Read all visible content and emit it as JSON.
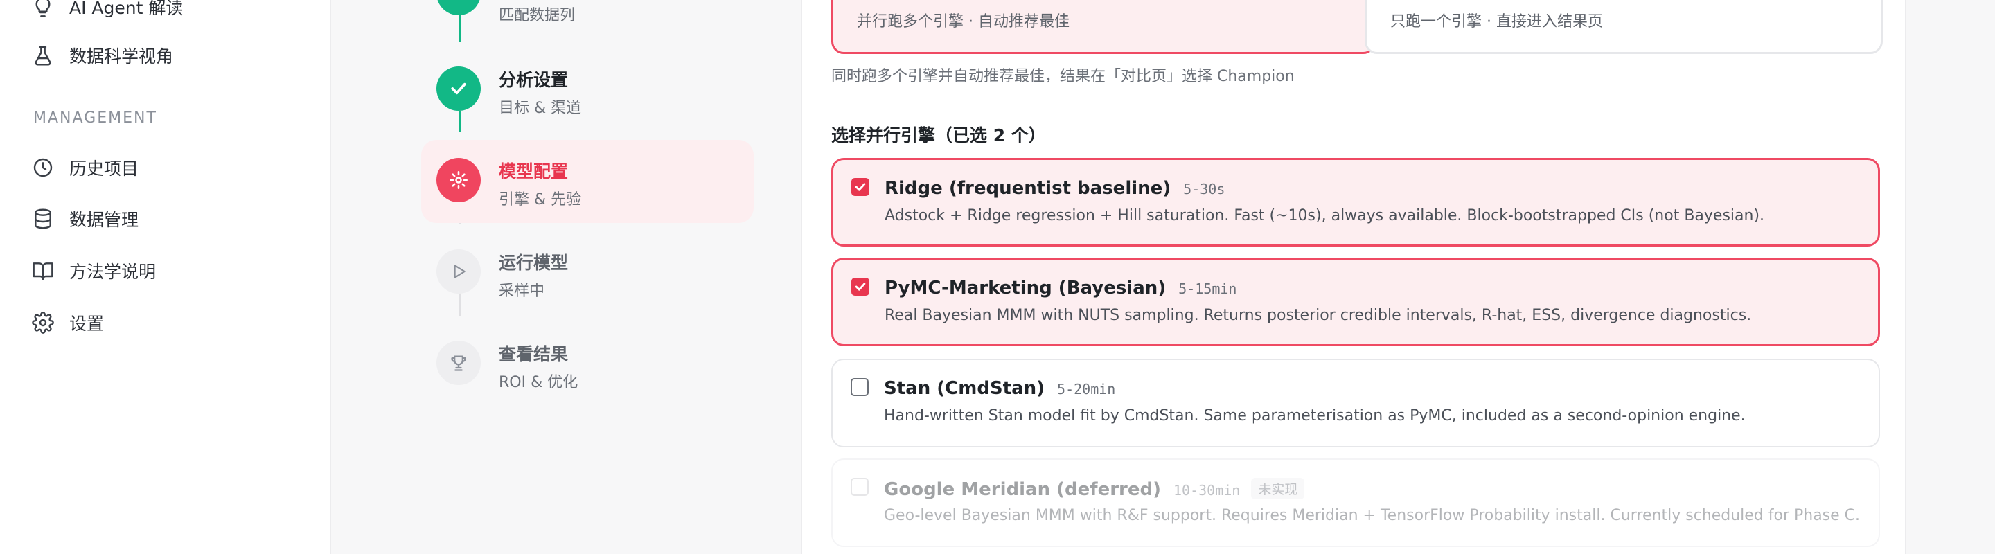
{
  "sidebar": {
    "items_top": [
      {
        "label": "AI Agent 解读",
        "icon": "lightbulb-icon"
      },
      {
        "label": "数据科学视角",
        "icon": "flask-icon"
      }
    ],
    "section_label": "MANAGEMENT",
    "items": [
      {
        "label": "历史项目",
        "icon": "clock-icon"
      },
      {
        "label": "数据管理",
        "icon": "database-icon"
      },
      {
        "label": "方法学说明",
        "icon": "book-icon"
      },
      {
        "label": "设置",
        "icon": "gear-icon"
      }
    ]
  },
  "steps": [
    {
      "title": "",
      "sub": "匹配数据列",
      "state": "done"
    },
    {
      "title": "分析设置",
      "sub": "目标 & 渠道",
      "state": "done"
    },
    {
      "title": "模型配置",
      "sub": "引擎 & 先验",
      "state": "active"
    },
    {
      "title": "运行模型",
      "sub": "采样中",
      "state": "todo"
    },
    {
      "title": "查看结果",
      "sub": "ROI & 优化",
      "state": "todo"
    }
  ],
  "mode": {
    "parallel_sub": "并行跑多个引擎 · 自动推荐最佳",
    "single_sub": "只跑一个引擎 · 直接进入结果页"
  },
  "hint": "同时跑多个引擎并自动推荐最佳，结果在「对比页」选择 Champion",
  "engines_title": "选择并行引擎（已选 2 个）",
  "engines": [
    {
      "name": "Ridge (frequentist baseline)",
      "time": "5-30s",
      "desc": "Adstock + Ridge regression + Hill saturation. Fast (~10s), always available. Block-bootstrapped CIs (not Bayesian).",
      "checked": true
    },
    {
      "name": "PyMC-Marketing (Bayesian)",
      "time": "5-15min",
      "desc": "Real Bayesian MMM with NUTS sampling. Returns posterior credible intervals, R-hat, ESS, divergence diagnostics.",
      "checked": true
    },
    {
      "name": "Stan (CmdStan)",
      "time": "5-20min",
      "desc": "Hand-written Stan model fit by CmdStan. Same parameterisation as PyMC, included as a second-opinion engine.",
      "checked": false
    },
    {
      "name": "Google Meridian (deferred)",
      "time": "10-30min",
      "badge": "未实现",
      "desc": "Geo-level Bayesian MMM with R&F support. Requires Meridian + TensorFlow Probability install. Currently scheduled for Phase C.",
      "checked": false,
      "disabled": true
    }
  ],
  "colors": {
    "accent": "#e8364f",
    "done": "#12b886"
  }
}
